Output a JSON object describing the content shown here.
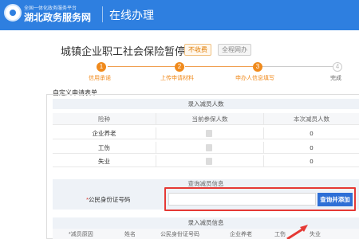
{
  "header": {
    "logo_small": "全国一体化政务服务平台",
    "logo_main": "湖北政务服务网",
    "subtitle": "在线办理"
  },
  "service": {
    "title": "城镇企业职工社会保险暂停",
    "tags": [
      "不收费",
      "全程网办"
    ]
  },
  "steps": [
    {
      "num": "1",
      "label": "信用承诺",
      "state": "done"
    },
    {
      "num": "2",
      "label": "上传申请材料",
      "state": "done"
    },
    {
      "num": "3",
      "label": "申办人信息填写",
      "state": "current"
    },
    {
      "num": "4",
      "label": "完成",
      "state": "todo"
    }
  ],
  "form": {
    "title": "自定义申请表单",
    "reduce_count_section": "录入减员人数",
    "columns": [
      "险种",
      "当前参保人数",
      "本次减员人数"
    ],
    "rows": [
      {
        "type": "企业养老",
        "current": "",
        "reduce": "0"
      },
      {
        "type": "工伤",
        "current": "",
        "reduce": "0"
      },
      {
        "type": "失业",
        "current": "",
        "reduce": "0"
      }
    ],
    "query_section": "查询减员信息",
    "id_label": "公民身份证号码",
    "id_required_mark": "*",
    "id_value": "",
    "query_button": "查询并添加",
    "reduce_info_section": "录入减员信息",
    "bottom_columns": [
      "*减员原因",
      "姓名",
      "公民身份证号码",
      "企业养老",
      "工伤",
      "失业"
    ]
  },
  "colors": {
    "brand_blue": "#2e7fe0",
    "step_orange": "#f08a1c",
    "highlight_red": "#e53935",
    "button_blue": "#2e6fd6"
  }
}
